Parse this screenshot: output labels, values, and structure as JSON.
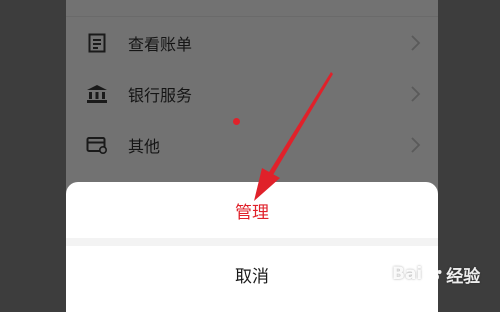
{
  "menu": {
    "items": [
      {
        "label": "查看账单",
        "icon": "bill-icon"
      },
      {
        "label": "银行服务",
        "icon": "bank-icon"
      },
      {
        "label": "其他",
        "icon": "card-icon"
      }
    ]
  },
  "action_sheet": {
    "primary_label": "管理",
    "cancel_label": "取消",
    "primary_color": "#e0212a"
  },
  "watermark": {
    "text_latin": "Bai",
    "text_cn": "经验"
  },
  "colors": {
    "overlay_bg": "#727272",
    "accent_red": "#e0212a"
  }
}
